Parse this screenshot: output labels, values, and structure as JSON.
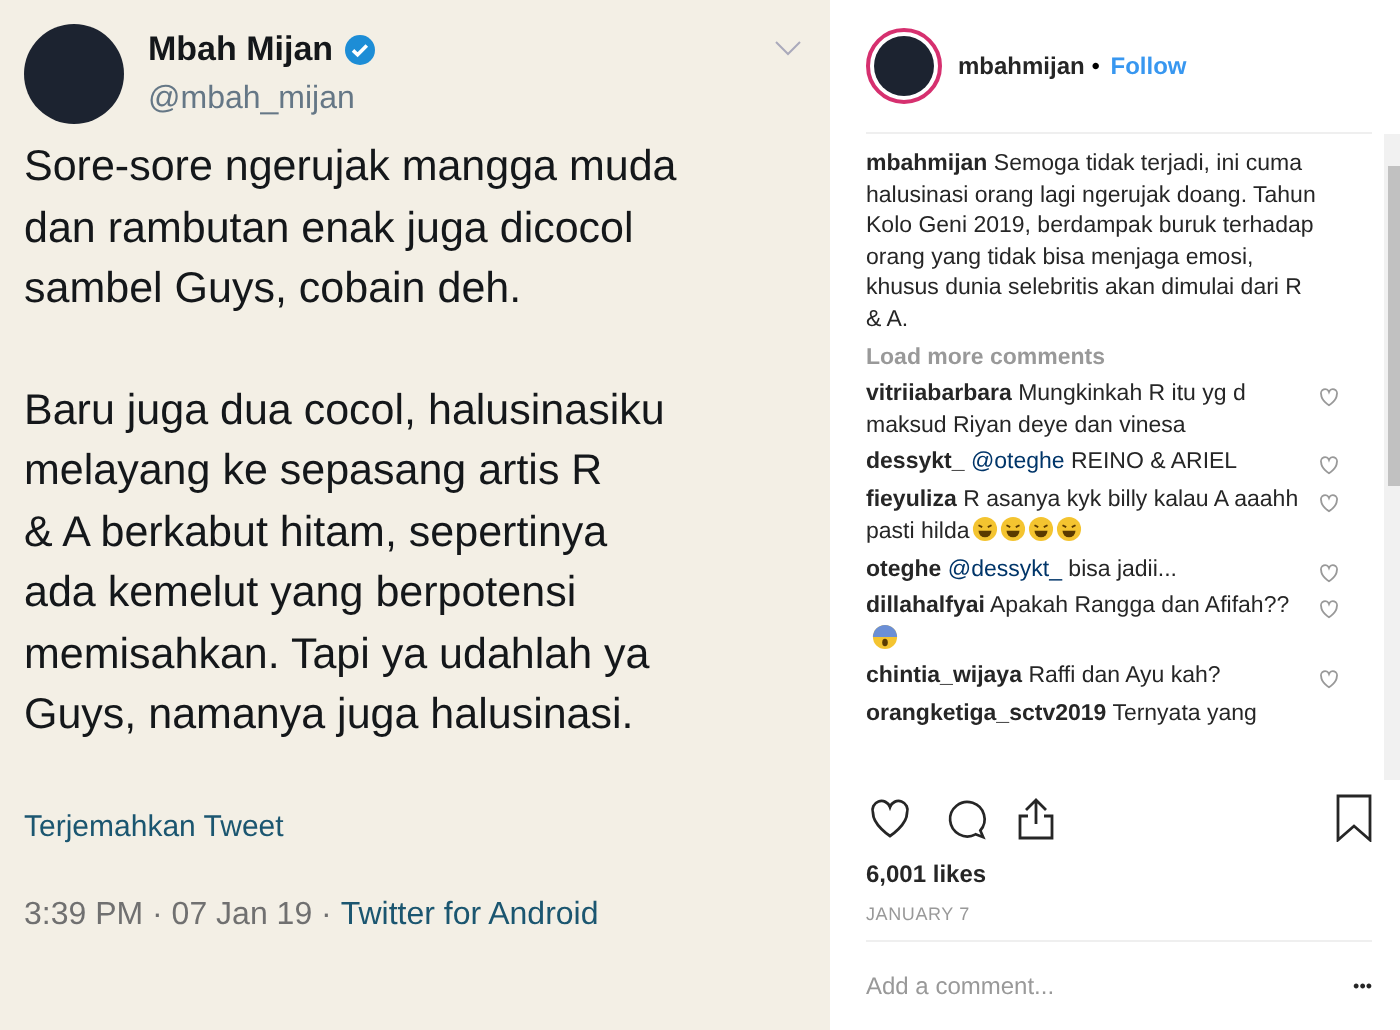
{
  "tweet": {
    "name": "Mbah Mijan",
    "verified": true,
    "handle": "@mbah_mijan",
    "paragraphs": [
      [
        "Sore-sore ngerujak mangga muda",
        "dan rambutan enak juga dicocol",
        "sambel Guys, cobain deh."
      ],
      [
        "Baru juga dua cocol, halusinasiku",
        "melayang ke sepasang artis R",
        "& A berkabut hitam, sepertinya",
        "ada kemelut yang berpotensi",
        "memisahkan. Tapi ya udahlah ya",
        "Guys, namanya juga halusinasi."
      ]
    ],
    "translate": "Terjemahkan Tweet",
    "time": "3:39 PM · 07 Jan 19 · ",
    "source": "Twitter for Android"
  },
  "instagram": {
    "username": "mbahmijan",
    "separator": "•",
    "follow": "Follow",
    "caption": {
      "user": "mbahmijan",
      "text": "Semoga tidak terjadi, ini cuma halusinasi orang lagi ngerujak doang. Tahun Kolo Geni 2019, berdampak buruk terhadap orang yang tidak bisa menjaga emosi, khusus dunia selebritis akan dimulai dari R & A."
    },
    "load_more": "Load more comments",
    "comments": [
      {
        "user": "vitriiabarbara",
        "text": "Mungkinkah R itu yg d maksud Riyan deye dan vinesa",
        "liked": false
      },
      {
        "user": "dessykt_",
        "mention": "@oteghe",
        "text": "REINO & ARIEL",
        "liked": false
      },
      {
        "user": "fieyuliza",
        "text": "R asanya kyk billy kalau A aaahh pasti hilda",
        "emojis": [
          {
            "kind": "laugh"
          },
          {
            "kind": "laugh"
          },
          {
            "kind": "laugh"
          },
          {
            "kind": "laugh"
          }
        ],
        "liked": false
      },
      {
        "user": "oteghe",
        "mention": "@dessykt_",
        "text": "bisa jadii...",
        "liked": false
      },
      {
        "user": "dillahalfyai",
        "text": "Apakah Rangga dan Afifah??",
        "emojis": [
          {
            "kind": "scream"
          }
        ],
        "liked": false
      },
      {
        "user": "chintia_wijaya",
        "text": "Raffi dan Ayu kah?",
        "liked": false
      },
      {
        "user": "orangketiga_sctv2019",
        "text": "Ternyata yang"
      }
    ],
    "likes": "6,001 likes",
    "date": "JANUARY 7",
    "add_comment_placeholder": "Add a comment...",
    "more": "•••"
  }
}
